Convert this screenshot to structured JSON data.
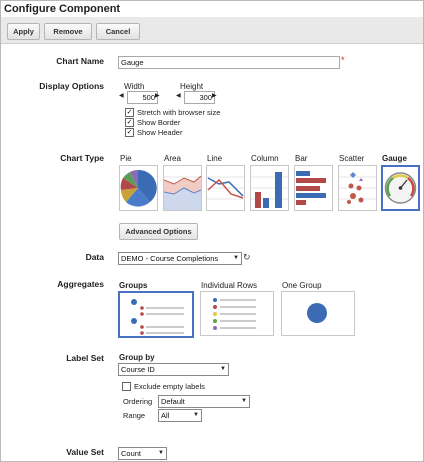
{
  "title": "Configure Component",
  "toolbar": {
    "apply": "Apply",
    "remove": "Remove",
    "cancel": "Cancel"
  },
  "chart_name": {
    "label": "Chart Name",
    "value": "Gauge",
    "required_mark": "*"
  },
  "display_options": {
    "label": "Display Options",
    "width_label": "Width",
    "width_value": "500",
    "height_label": "Height",
    "height_value": "300",
    "checkboxes": [
      {
        "label": "Stretch with browser size",
        "checked": true
      },
      {
        "label": "Show Border",
        "checked": true
      },
      {
        "label": "Show Header",
        "checked": true
      }
    ]
  },
  "chart_type": {
    "label": "Chart Type",
    "types": [
      "Pie",
      "Area",
      "Line",
      "Column",
      "Bar",
      "Scatter",
      "Gauge"
    ],
    "selected": "Gauge",
    "advanced_button": "Advanced Options"
  },
  "data": {
    "label": "Data",
    "value": "DEMO - Course Completions",
    "refresh_icon": "refresh-icon"
  },
  "aggregates": {
    "label": "Aggregates",
    "options": [
      "Groups",
      "Individual Rows",
      "One Group"
    ],
    "selected": "Groups"
  },
  "label_set": {
    "label": "Label Set",
    "group_by_label": "Group by",
    "group_by_value": "Course ID",
    "exclude_label": "Exclude empty labels",
    "exclude_checked": false,
    "ordering_label": "Ordering",
    "ordering_value": "Default",
    "range_label": "Range",
    "range_value": "All"
  },
  "value_set": {
    "label": "Value Set",
    "value": "Count"
  },
  "colors": {
    "accent": "#4a70c4",
    "pie_blue": "#3b6cb3",
    "red": "#b24848",
    "toolbar_bg": "#e9e9e9"
  }
}
